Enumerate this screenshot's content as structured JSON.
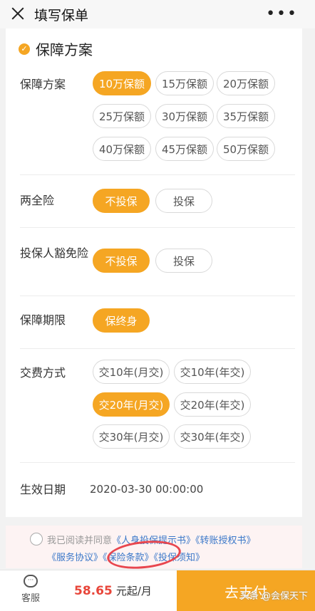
{
  "header": {
    "title": "填写保单"
  },
  "section": {
    "title": "保障方案",
    "check": "✓"
  },
  "rows": {
    "plan": {
      "label": "保障方案",
      "options": [
        "10万保额",
        "15万保额",
        "20万保额",
        "25万保额",
        "30万保额",
        "35万保额",
        "40万保额",
        "45万保额",
        "50万保额"
      ],
      "selected": "10万保额"
    },
    "two_insurance": {
      "label": "两全险",
      "options": [
        "不投保",
        "投保"
      ],
      "selected": "不投保"
    },
    "waiver": {
      "label": "投保人豁免险",
      "options": [
        "不投保",
        "投保"
      ],
      "selected": "不投保"
    },
    "term": {
      "label": "保障期限",
      "options": [
        "保终身"
      ],
      "selected": "保终身"
    },
    "payment": {
      "label": "交费方式",
      "options": [
        "交10年(月交)",
        "交10年(年交)",
        "交20年(月交)",
        "交20年(年交)",
        "交30年(月交)",
        "交30年(年交)"
      ],
      "selected": "交20年(月交)"
    },
    "effective_date": {
      "label": "生效日期",
      "value": "2020-03-30 00:00:00"
    }
  },
  "agreement": {
    "prefix": "我已阅读并同意",
    "doc1": "《人身投保提示书》",
    "doc2": "《转账授权书》",
    "doc3": "《服务协议》",
    "doc4": "《保险条款》",
    "doc5": "《投保须知》"
  },
  "footer": {
    "service_label": "客服",
    "price": "58.65",
    "price_unit": "元起/月",
    "pay_label": "去支付",
    "watermark": "头条 @会保天下"
  },
  "colors": {
    "accent": "#f5a623",
    "price": "#e8463a",
    "link": "#3b78c9",
    "annotation": "#e8464e"
  }
}
